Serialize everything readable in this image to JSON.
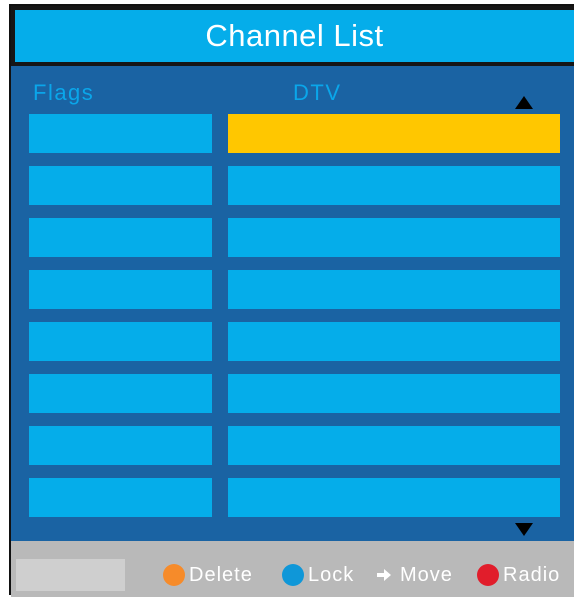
{
  "window": {
    "title": "Channel List"
  },
  "columns": {
    "flags": "Flags",
    "channels": "DTV"
  },
  "list": {
    "row_count": 8,
    "selected_row_index": 0
  },
  "footer": {
    "actions": [
      {
        "label": "Delete",
        "icon": "orange-dot-icon",
        "color": "#f68b2a"
      },
      {
        "label": "Lock",
        "icon": "blue-dot-icon",
        "color": "#0f97d8"
      },
      {
        "label": "Move",
        "icon": "right-arrow-icon",
        "color": "#ffffff"
      },
      {
        "label": "Radio",
        "icon": "red-dot-icon",
        "color": "#e11d2b"
      }
    ]
  },
  "colors": {
    "panel": "#1a63a3",
    "title": "#05adea",
    "row": "#05adea",
    "selected": "#ffc700",
    "footer": "#b9b9b9"
  }
}
